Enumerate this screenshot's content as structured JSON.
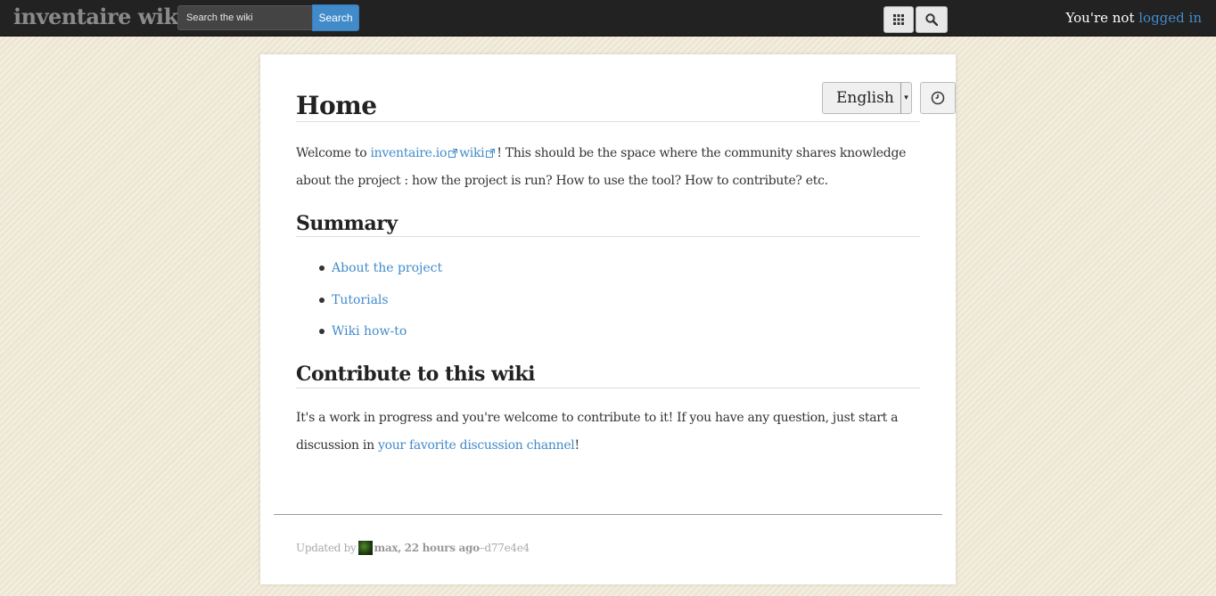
{
  "topbar": {
    "brand": "inventaire wiki",
    "search_placeholder": "Search the wiki",
    "search_button": "Search",
    "apps_icon": "grid-icon",
    "search_icon": "magnifier-icon",
    "login_prefix": "You're not ",
    "login_link": "logged in"
  },
  "page": {
    "title": "Home",
    "language": "English",
    "history_icon": "clock-icon",
    "intro": {
      "before": "Welcome to ",
      "link1": "inventaire.io",
      "link2": "wiki",
      "after": "! This should be the space where the community shares knowledge about the project : how the project is run? How to use the tool? How to contribute? etc."
    },
    "summary_heading": "Summary",
    "summary_items": [
      {
        "label": "About the project"
      },
      {
        "label": "Tutorials"
      },
      {
        "label": "Wiki how-to"
      }
    ],
    "contribute_heading": "Contribute to this wiki",
    "contribute": {
      "text": "It's a work in progress and you're welcome to contribute to it! If you have any question, just start a discussion in ",
      "link": "your favorite discussion channel",
      "after": "!"
    }
  },
  "footer": {
    "updated_by": "Updated by",
    "user": "max",
    "sep": ",",
    "time": "22 hours ago",
    "dash": " – ",
    "commit": "d77e4e4"
  },
  "colors": {
    "accent": "#428bca",
    "topbar": "#222222",
    "background": "#ede6d3"
  }
}
